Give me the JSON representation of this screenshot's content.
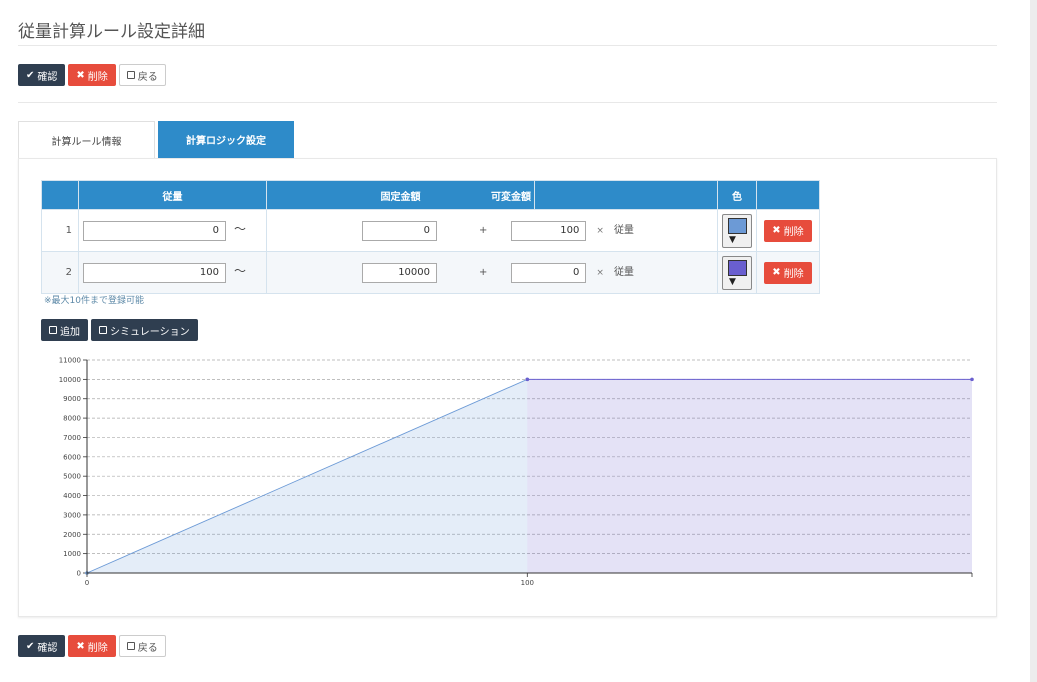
{
  "page": {
    "title": "従量計算ルール設定詳細"
  },
  "top_buttons": {
    "confirm": "確認",
    "delete": "削除",
    "back": "戻る"
  },
  "bottom_buttons": {
    "confirm": "確認",
    "delete": "削除",
    "back": "戻る"
  },
  "tabs": [
    {
      "label": "計算ルール情報"
    },
    {
      "label": "計算ロジック設定"
    }
  ],
  "table": {
    "headers": {
      "no": "",
      "usage": "従量",
      "fixed": "固定金額",
      "variable": "可変金額",
      "color": "色",
      "action": ""
    },
    "rows": [
      {
        "no": "1",
        "from": "0",
        "tilde": "〜",
        "fixed": "0",
        "plus": "+",
        "variable": "100",
        "times": "×",
        "unit": "従量",
        "color": "#6c9ad6",
        "delete": "削除"
      },
      {
        "no": "2",
        "from": "100",
        "tilde": "〜",
        "fixed": "10000",
        "plus": "+",
        "variable": "0",
        "times": "×",
        "unit": "従量",
        "color": "#6a5fcf",
        "delete": "削除"
      }
    ]
  },
  "note": "※最大10件まで登録可能",
  "actions": {
    "add": "追加",
    "simulate": "シミュレーション"
  },
  "chart_data": {
    "type": "area",
    "x_ticks": [
      "0",
      "100"
    ],
    "y_ticks": [
      "0",
      "1000",
      "2000",
      "3000",
      "4000",
      "5000",
      "6000",
      "7000",
      "8000",
      "9000",
      "10000",
      "11000"
    ],
    "ylim": [
      0,
      11000
    ],
    "xlim": [
      0,
      201
    ],
    "grid": true,
    "series": [
      {
        "color": "#6c9ad6",
        "points": [
          [
            0,
            0
          ],
          [
            100,
            10000
          ]
        ]
      },
      {
        "color": "#6a5fcf",
        "points": [
          [
            100,
            10000
          ],
          [
            201,
            10000
          ]
        ]
      }
    ]
  }
}
